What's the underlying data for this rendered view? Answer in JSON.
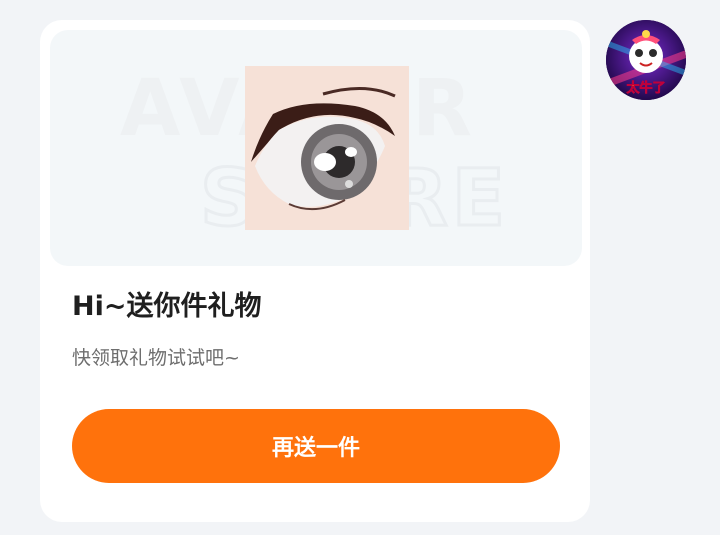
{
  "gift_card": {
    "title": "Hi~送你件礼物",
    "subtitle": "快领取礼物试试吧~",
    "action_label": "再送一件",
    "watermark_text": [
      "AVATAR",
      "STORE"
    ],
    "item_icon": "anime-eye-icon"
  },
  "sender": {
    "avatar_icon": "anime-character-avatar",
    "avatar_caption": "太牛了"
  },
  "colors": {
    "accent": "#ff720c",
    "page_background": "#f2f4f7",
    "card_background": "#ffffff"
  }
}
